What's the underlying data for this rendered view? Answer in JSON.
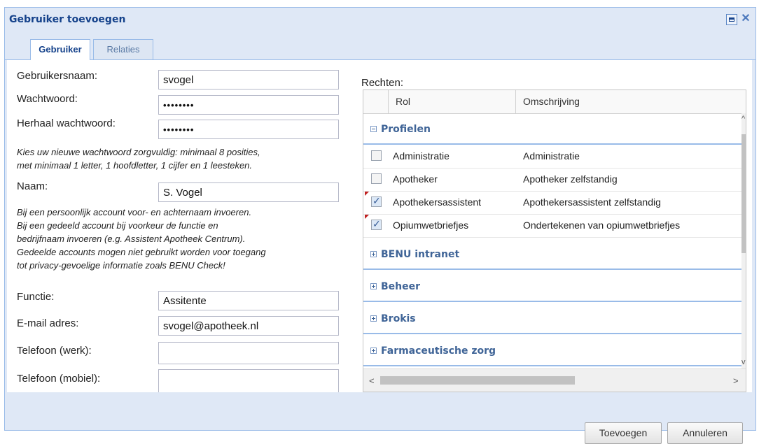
{
  "window": {
    "title": "Gebruiker toevoegen"
  },
  "tabs": [
    {
      "label": "Gebruiker",
      "active": true
    },
    {
      "label": "Relaties",
      "active": false
    }
  ],
  "form": {
    "username": {
      "label": "Gebruikersnaam:",
      "value": "svogel"
    },
    "password": {
      "label": "Wachtwoord:",
      "value": "••••••••"
    },
    "password_repeat": {
      "label": "Herhaal wachtwoord:",
      "value": "••••••••"
    },
    "password_note_1": "Kies uw nieuwe wachtwoord zorgvuldig: minimaal 8 posities,",
    "password_note_2": "met minimaal 1 letter, 1 hoofdletter, 1 cijfer en 1 leesteken.",
    "name": {
      "label": "Naam:",
      "value": "S. Vogel"
    },
    "name_note": [
      "Bij een persoonlijk account voor- en achternaam invoeren.",
      "Bij een gedeeld account bij voorkeur de functie en",
      "bedrijfnaam invoeren (e.g. Assistent Apotheek Centrum).",
      "Gedeelde accounts mogen niet gebruikt worden voor toegang",
      "tot privacy-gevoelige informatie zoals BENU Check!"
    ],
    "function": {
      "label": "Functie:",
      "value": "Assitente"
    },
    "email": {
      "label": "E-mail adres:",
      "value": "svogel@apotheek.nl"
    },
    "phone_work": {
      "label": "Telefoon (werk):",
      "value": ""
    },
    "phone_mobile": {
      "label": "Telefoon (mobiel):",
      "value": ""
    }
  },
  "rights": {
    "label": "Rechten:",
    "columns": [
      "Rol",
      "Omschrijving"
    ],
    "groups": [
      {
        "title": "Profielen",
        "expanded": true,
        "rows": [
          {
            "role": "Administratie",
            "description": "Administratie",
            "checked": false,
            "dirty": false
          },
          {
            "role": "Apotheker",
            "description": "Apotheker zelfstandig",
            "checked": false,
            "dirty": false
          },
          {
            "role": "Apothekersassistent",
            "description": "Apothekersassistent zelfstandig",
            "checked": true,
            "dirty": true
          },
          {
            "role": "Opiumwetbriefjes",
            "description": "Ondertekenen van opiumwetbriefjes",
            "checked": true,
            "dirty": true
          }
        ]
      },
      {
        "title": "BENU intranet",
        "expanded": false
      },
      {
        "title": "Beheer",
        "expanded": false
      },
      {
        "title": "Brokis",
        "expanded": false
      },
      {
        "title": "Farmaceutische zorg",
        "expanded": false
      }
    ]
  },
  "buttons": {
    "add": "Toevoegen",
    "cancel": "Annuleren"
  }
}
